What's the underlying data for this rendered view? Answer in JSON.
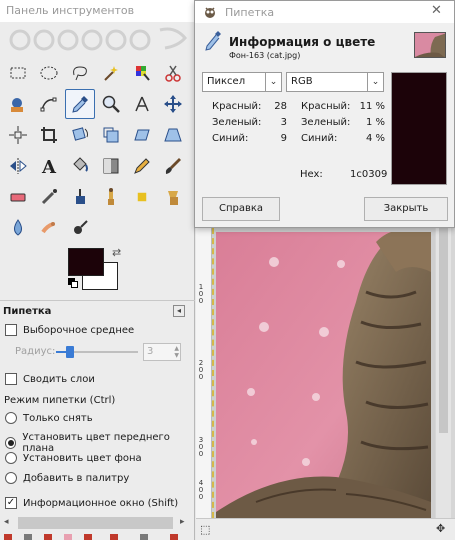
{
  "toolbox": {
    "title": "Панель инструментов",
    "tools": [
      "rect-select-icon",
      "ellipse-select-icon",
      "lasso-icon",
      "fuzzy-select-icon",
      "color-select-icon",
      "scissors-icon",
      "foreground-select-icon",
      "paths-icon",
      "color-picker-icon",
      "zoom-icon",
      "measure-icon",
      "move-icon",
      "align-icon",
      "crop-icon",
      "rotate-icon",
      "scale-icon",
      "shear-icon",
      "perspective-icon",
      "flip-icon",
      "text-icon",
      "bucket-fill-icon",
      "blend-icon",
      "pencil-icon",
      "paintbrush-icon",
      "eraser-icon",
      "airbrush-icon",
      "ink-icon",
      "clone-icon",
      "heal-icon",
      "perspective-clone-icon",
      "blur-icon",
      "smudge-icon",
      "dodge-burn-icon"
    ],
    "active_tool_index": 8,
    "fg_color": "#1c0309",
    "bg_color": "#ffffff",
    "options": {
      "panel_title": "Пипетка",
      "sample_average": {
        "label": "Выборочное среднее",
        "checked": false
      },
      "radius_label": "Радиус:",
      "radius_value": "3",
      "sample_merged": {
        "label": "Сводить слои",
        "checked": false
      },
      "mode_title": "Режим пипетки  (Ctrl)",
      "modes": [
        {
          "label": "Только снять",
          "selected": false
        },
        {
          "label": "Установить цвет переднего плана",
          "selected": true
        },
        {
          "label": "Установить цвет фона",
          "selected": false
        },
        {
          "label": "Добавить в палитру",
          "selected": false
        }
      ],
      "info_window": {
        "label": "Информационное окно  (Shift)",
        "checked": true
      }
    }
  },
  "canvas": {
    "ruler_labels": [
      "1",
      "0",
      "0",
      "2",
      "0",
      "0",
      "3",
      "0",
      "0",
      "4",
      "0",
      "0"
    ]
  },
  "dialog": {
    "title": "Пипетка",
    "heading": "Информация о цвете",
    "subheading": "Фон-163 (cat.jpg)",
    "left_combo": "Пиксел",
    "right_combo": "RGB",
    "left_values": [
      {
        "label": "Красный:",
        "value": "28"
      },
      {
        "label": "Зеленый:",
        "value": "3"
      },
      {
        "label": "Синий:",
        "value": "9"
      }
    ],
    "right_values": [
      {
        "label": "Красный:",
        "value": "11 %"
      },
      {
        "label": "Зеленый:",
        "value": "1 %"
      },
      {
        "label": "Синий:",
        "value": "4 %"
      }
    ],
    "hex_label": "Hex:",
    "hex_value": "1c0309",
    "swatch_color": "#1c0309",
    "help_button": "Справка",
    "close_button": "Закрыть"
  }
}
